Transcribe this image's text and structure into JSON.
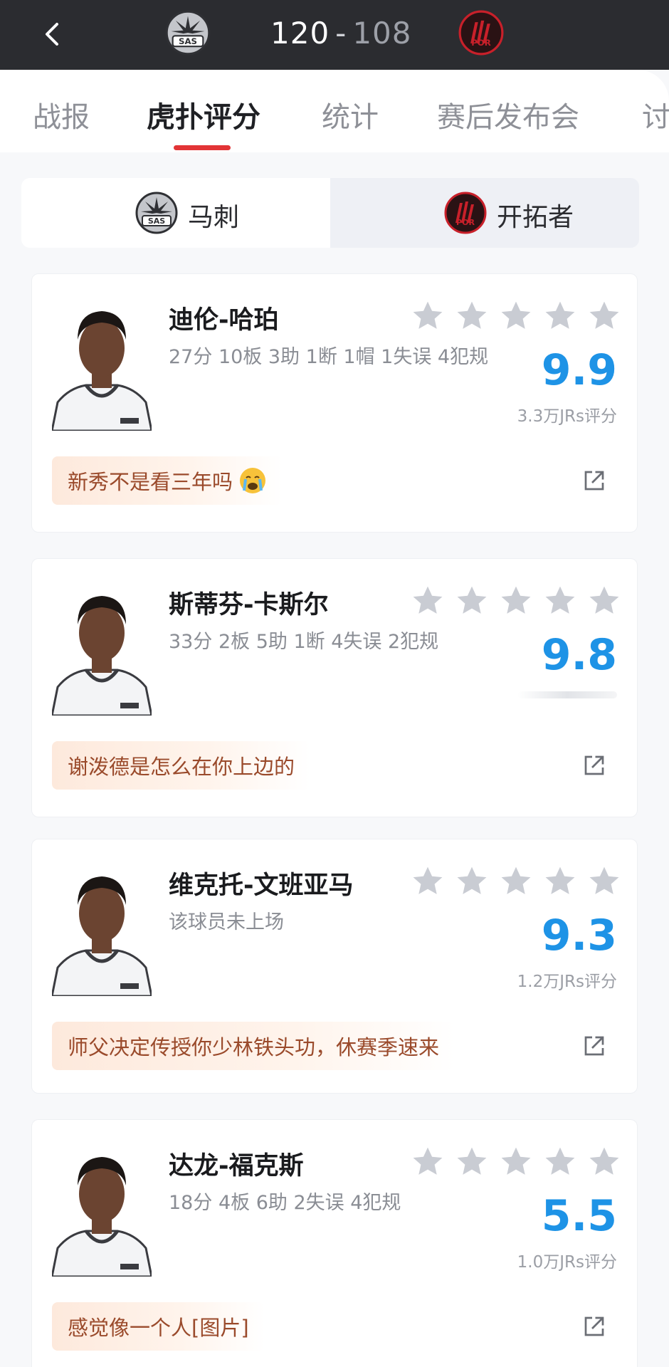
{
  "header": {
    "back_icon": "chevron-left-icon",
    "home_team_logo": "spurs-logo",
    "away_team_logo": "blazers-logo",
    "home_score": "120",
    "separator": "-",
    "away_score": "108"
  },
  "tabs": [
    {
      "label": "战报",
      "active": false
    },
    {
      "label": "虎扑评分",
      "active": true
    },
    {
      "label": "统计",
      "active": false
    },
    {
      "label": "赛后发布会",
      "active": false
    },
    {
      "label": "讨",
      "active": false
    }
  ],
  "team_switch": {
    "home": {
      "label": "马刺",
      "logo": "spurs-logo",
      "active": true
    },
    "away": {
      "label": "开拓者",
      "logo": "blazers-logo",
      "active": false
    }
  },
  "colors": {
    "rating_blue": "#1e93e6",
    "tab_indicator_red": "#e23436",
    "comment_text": "#9a4a2b",
    "star_gray": "#c9ccd3"
  },
  "players": [
    {
      "name": "迪伦-哈珀",
      "stats": "27分 10板 3助 1断 1帽 1失误 4犯规",
      "rating": "9.9",
      "rating_count": "3.3万JRs评分",
      "comment": "新秀不是看三年吗",
      "comment_emoji": "crying-emoji",
      "stars_filled": 0
    },
    {
      "name": "斯蒂芬-卡斯尔",
      "stats": "33分 2板 5助 1断 4失误 2犯规",
      "rating": "9.8",
      "rating_count": "",
      "comment": "谢泼德是怎么在你上边的",
      "stars_filled": 0
    },
    {
      "name": "维克托-文班亚马",
      "stats": "该球员未上场",
      "rating": "9.3",
      "rating_count": "1.2万JRs评分",
      "comment": "师父决定传授你少林铁头功，休赛季速来",
      "stars_filled": 0
    },
    {
      "name": "达龙-福克斯",
      "stats": "18分 4板 6助 2失误 4犯规",
      "rating": "5.5",
      "rating_count": "1.0万JRs评分",
      "comment": "感觉像一个人[图片]",
      "stars_filled": 0
    }
  ]
}
